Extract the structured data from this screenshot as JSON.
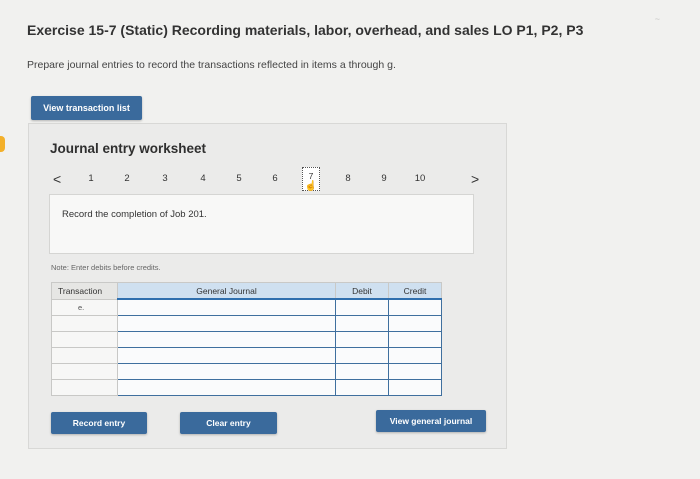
{
  "header": {
    "title": "Exercise 15-7 (Static) Recording materials, labor, overhead, and sales LO P1, P2, P3",
    "instructions": "Prepare journal entries to record the transactions reflected in items a through g."
  },
  "view_transaction_label": "View transaction list",
  "worksheet": {
    "title": "Journal entry worksheet",
    "pager": {
      "prev": "<",
      "next": ">",
      "pages": [
        "1",
        "2",
        "3",
        "4",
        "5",
        "6",
        "7",
        "8",
        "9",
        "10"
      ],
      "active_page": "7"
    },
    "description": "Record the completion of Job 201.",
    "note": "Note: Enter debits before credits.",
    "table": {
      "headers": {
        "transaction": "Transaction",
        "general_journal": "General Journal",
        "debit": "Debit",
        "credit": "Credit"
      },
      "rows": [
        {
          "transaction": "e.",
          "account": "",
          "debit": "",
          "credit": ""
        },
        {
          "transaction": "",
          "account": "",
          "debit": "",
          "credit": ""
        },
        {
          "transaction": "",
          "account": "",
          "debit": "",
          "credit": ""
        },
        {
          "transaction": "",
          "account": "",
          "debit": "",
          "credit": ""
        },
        {
          "transaction": "",
          "account": "",
          "debit": "",
          "credit": ""
        },
        {
          "transaction": "",
          "account": "",
          "debit": "",
          "credit": ""
        }
      ]
    },
    "buttons": {
      "record": "Record entry",
      "clear": "Clear entry",
      "view_journal": "View general journal"
    }
  },
  "colors": {
    "button": "#3a6a9c",
    "header_accent": "#2f6fae",
    "tab": "#f3b02a"
  },
  "icons": {
    "prev": "chevron-left-icon",
    "next": "chevron-right-icon",
    "cursor": "hand-pointer-icon"
  }
}
